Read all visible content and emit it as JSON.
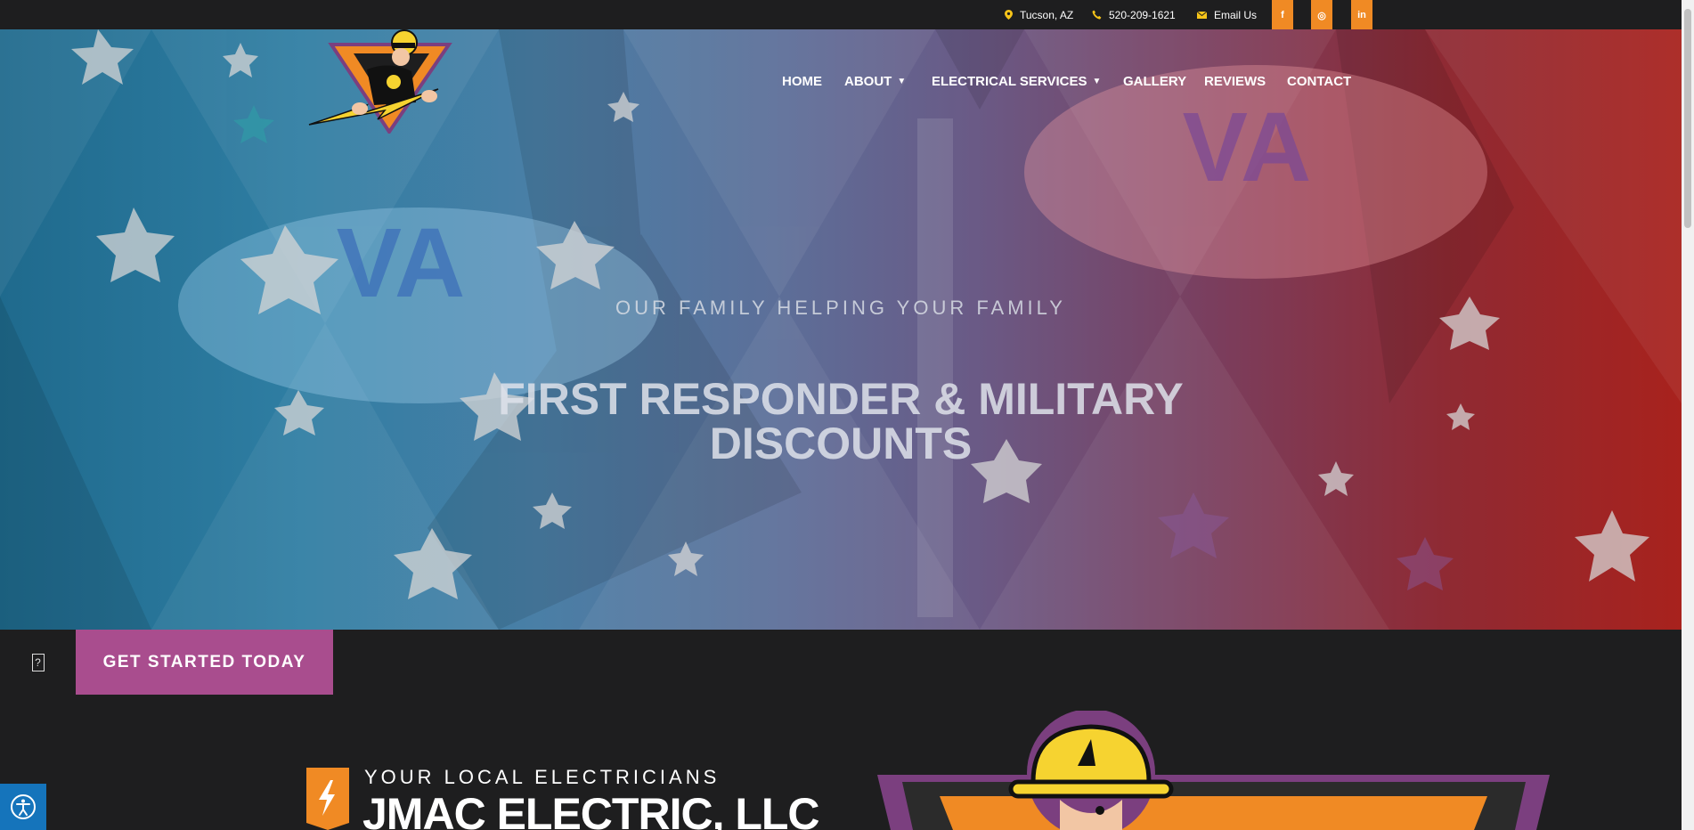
{
  "topbar": {
    "location": "Tucson, AZ",
    "phone": "520-209-1621",
    "email": "Email Us",
    "social": [
      {
        "name": "facebook",
        "glyph": "f"
      },
      {
        "name": "instagram",
        "glyph": "◎"
      },
      {
        "name": "linkedin",
        "glyph": "in"
      }
    ]
  },
  "nav": {
    "items": [
      "HOME",
      "ABOUT",
      "ELECTRICAL SERVICES",
      "GALLERY",
      "REVIEWS",
      "CONTACT"
    ]
  },
  "hero": {
    "kicker": "OUR FAMILY HELPING YOUR FAMILY",
    "headline_line1": "FIRST RESPONDER & MILITARY",
    "headline_line2": "DISCOUNTS",
    "background_text": "VA"
  },
  "cta": {
    "label": "GET STARTED TODAY",
    "help_glyph": "?"
  },
  "about": {
    "kicker": "YOUR LOCAL ELECTRICIANS",
    "title": "JMAC ELECTRIC, LLC"
  },
  "colors": {
    "topbar_bg": "#1e1e1f",
    "accent_orange": "#f08a24",
    "accent_yellow": "#f6c419",
    "cta_purple": "#a94d8e",
    "access_blue": "#1574bb"
  },
  "icons": [
    "map-marker-icon",
    "phone-icon",
    "envelope-icon",
    "bolt-icon",
    "accessibility-icon",
    "help-icon"
  ]
}
